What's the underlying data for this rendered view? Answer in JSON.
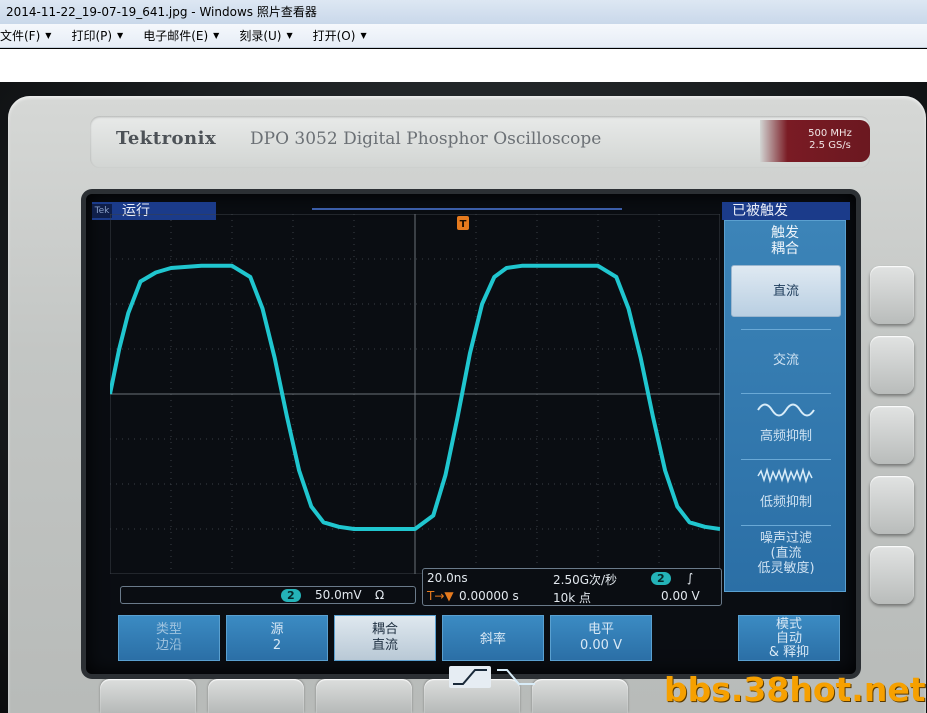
{
  "window": {
    "title": "2014-11-22_19-07-19_641.jpg - Windows 照片查看器",
    "menu": [
      {
        "label": "文件(F)"
      },
      {
        "label": "打印(P)"
      },
      {
        "label": "电子邮件(E)"
      },
      {
        "label": "刻录(U)"
      },
      {
        "label": "打开(O)"
      }
    ]
  },
  "scope": {
    "brand": "Tektronix",
    "model": "DPO 3052 Digital Phosphor Oscilloscope",
    "spec_line1": "500 MHz",
    "spec_line2": "2.5 GS/s",
    "status_left": "运行",
    "status_badge": "Tek",
    "status_right": "已被触发",
    "trigger_marker": "T",
    "channel_marker": "2",
    "trigger_panel": {
      "title": "触发\n耦合",
      "options": [
        "直流",
        "交流",
        "高频抑制",
        "低频抑制",
        "噪声过滤\n(直流\n低灵敏度)"
      ],
      "selected": "直流"
    },
    "readout_left": {
      "channel": "2",
      "volts_div": "50.0mV",
      "impedance": "Ω"
    },
    "readout_center": {
      "time_div": "20.0ns",
      "sample_rate": "2.50G次/秒",
      "trigger_pos": "0.00000 s",
      "record_length": "10k 点",
      "trig_channel": "2",
      "trig_slope": "∫",
      "trig_level": "0.00 V",
      "trig_icon": "T→▼"
    },
    "bottom_menu": [
      {
        "label": "类型\n边沿"
      },
      {
        "label": "源\n2"
      },
      {
        "label": "耦合\n直流"
      },
      {
        "label": "斜率"
      },
      {
        "label": "电平\n0.00 V"
      },
      {
        "label": "模式\n自动\n& 释抑"
      }
    ]
  },
  "watermark": "bbs.38hot.net",
  "colors": {
    "trace": "#20c6cf",
    "menu_blue": "#2b6fa6",
    "status_blue": "#1b3b8a",
    "watermark": "#f6a000"
  },
  "chart_data": {
    "type": "line",
    "title": "",
    "xlabel": "",
    "ylabel": "",
    "x_units": "div",
    "y_units": "div",
    "xlim": [
      0,
      10
    ],
    "ylim": [
      -4,
      4
    ],
    "grid": true,
    "series": [
      {
        "x": [
          0.0,
          0.15,
          0.3,
          0.5,
          0.75,
          1.0,
          1.5,
          2.0,
          2.3,
          2.5,
          2.7,
          2.9,
          3.1,
          3.3,
          3.5,
          3.75,
          4.0,
          4.5,
          5.0,
          5.3,
          5.5,
          5.7,
          5.9,
          6.1,
          6.3,
          6.5,
          6.75,
          7.0,
          7.5,
          8.0,
          8.3,
          8.5,
          8.7,
          8.9,
          9.1,
          9.3,
          9.5,
          9.75,
          10.0
        ],
        "y": [
          0.0,
          1.0,
          1.8,
          2.5,
          2.7,
          2.8,
          2.85,
          2.85,
          2.6,
          1.9,
          0.8,
          -0.5,
          -1.7,
          -2.5,
          -2.85,
          -2.95,
          -3.0,
          -3.0,
          -3.0,
          -2.7,
          -1.8,
          -0.5,
          0.9,
          2.0,
          2.6,
          2.8,
          2.85,
          2.85,
          2.85,
          2.85,
          2.6,
          1.9,
          0.8,
          -0.5,
          -1.7,
          -2.5,
          -2.85,
          -2.95,
          -3.0
        ]
      }
    ]
  }
}
